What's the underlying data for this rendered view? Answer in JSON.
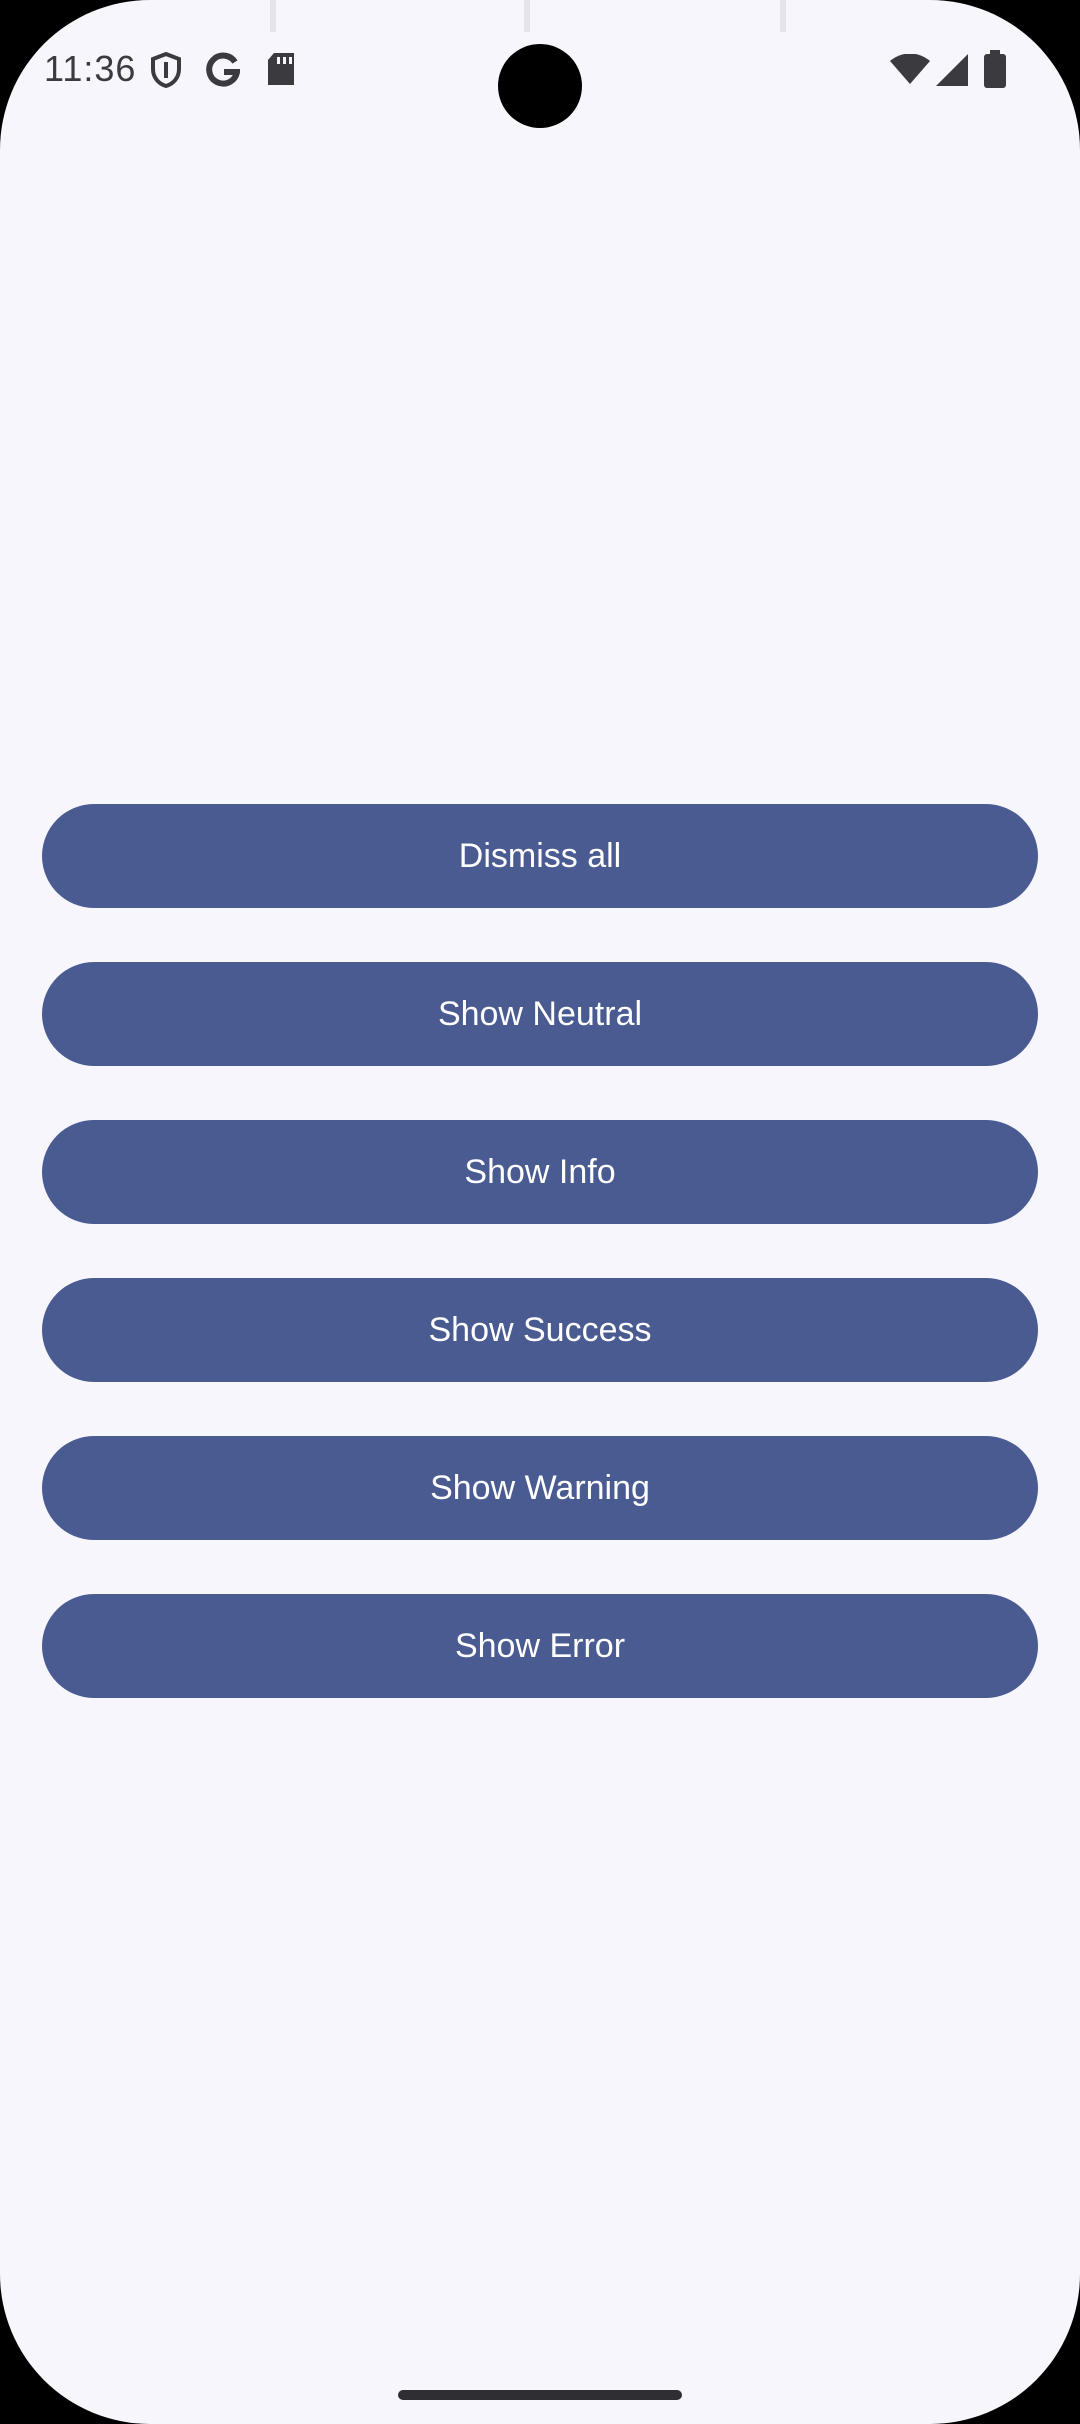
{
  "status_bar": {
    "time": "11:36",
    "left_icons": [
      "vpn-shield-icon",
      "google-icon",
      "sd-card-icon"
    ],
    "right_icons": [
      "wifi-icon",
      "cell-signal-icon",
      "battery-icon"
    ]
  },
  "buttons": [
    {
      "label": "Dismiss all"
    },
    {
      "label": "Show Neutral"
    },
    {
      "label": "Show Info"
    },
    {
      "label": "Show Success"
    },
    {
      "label": "Show Warning"
    },
    {
      "label": "Show Error"
    }
  ],
  "colors": {
    "background": "#F7F6FD",
    "button": "#4A5B92",
    "button_text": "#FFFFFF"
  }
}
